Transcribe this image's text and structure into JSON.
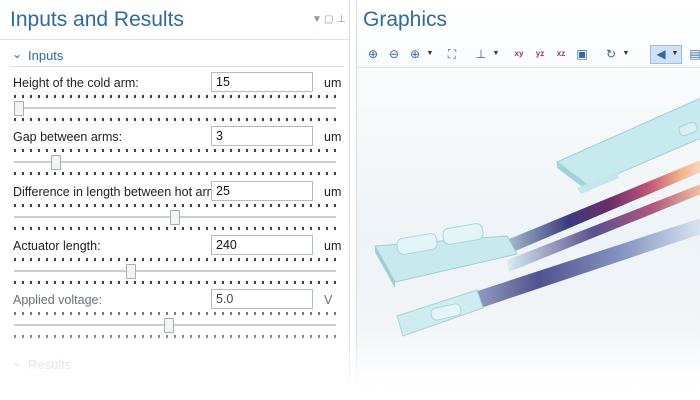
{
  "left_panel": {
    "title": "Inputs and Results",
    "section": "Inputs",
    "results_section": "Results",
    "params": [
      {
        "label": "Height of the cold arm:",
        "value": "15",
        "unit": "um",
        "slider_fraction": 0.0,
        "enabled": true
      },
      {
        "label": "Gap between arms:",
        "value": "3",
        "unit": "um",
        "slider_fraction": 0.12,
        "enabled": true
      },
      {
        "label": "Difference in length between hot arms:",
        "value": "25",
        "unit": "um",
        "slider_fraction": 0.5,
        "enabled": true
      },
      {
        "label": "Actuator length:",
        "value": "240",
        "unit": "um",
        "slider_fraction": 0.36,
        "enabled": true
      },
      {
        "label": "Applied voltage:",
        "value": "5.0",
        "unit": "V",
        "slider_fraction": 0.48,
        "enabled": false
      }
    ]
  },
  "graphics": {
    "title": "Graphics",
    "toolbar_icons": [
      "zoom-in-icon",
      "zoom-out-icon",
      "zoom-box-icon",
      "zoom-extents-icon",
      "axis-orientation-icon",
      "xy-plane-icon",
      "yz-plane-icon",
      "xz-plane-icon",
      "view-3d-icon",
      "rotate-icon",
      "speaker-icon",
      "screenshot-icon"
    ],
    "toolbar_labels": {
      "xy": "xy",
      "yz": "yz",
      "xz": "xz"
    }
  },
  "colors": {
    "accent": "#2b6aa3",
    "thermal_hot": "#f2b389",
    "thermal_cold": "#2e2a6a",
    "model_surface": "#bfe7ec"
  }
}
